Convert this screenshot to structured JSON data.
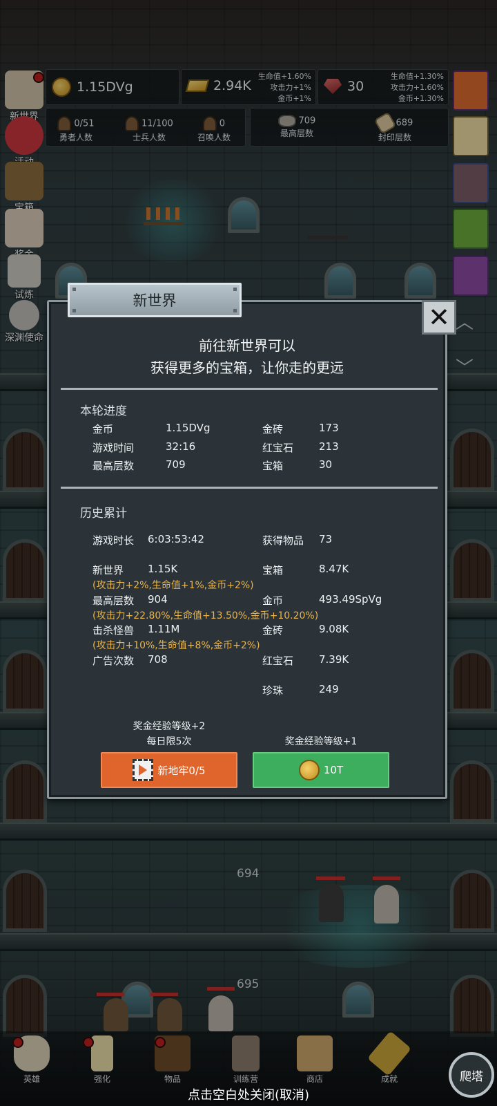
{
  "resources": {
    "gold": "1.15DVg",
    "gold_bar": "2.94K",
    "gold_bar_bonus": [
      "生命值+1.60%",
      "攻击力+1%",
      "金币+1%"
    ],
    "ruby": "30",
    "ruby_bonus": [
      "生命值+1.30%",
      "攻击力+1.60%",
      "金币+1.30%"
    ]
  },
  "counts": {
    "heroes": {
      "value": "0/51",
      "label": "勇者人数"
    },
    "soldiers": {
      "value": "11/100",
      "label": "士兵人数"
    },
    "summons": {
      "value": "0",
      "label": "召唤人数"
    },
    "max_floor": {
      "value": "709",
      "label": "最高层数"
    },
    "sealed_floor": {
      "value": "689",
      "label": "封印层数"
    }
  },
  "side_menu": [
    "新世界",
    "活动",
    "宝箱",
    "奖金",
    "试炼",
    "深渊使命"
  ],
  "dialog": {
    "title": "新世界",
    "intro_line1": "前往新世界可以",
    "intro_line2": "获得更多的宝箱，让你走的更远",
    "current": {
      "title": "本轮进度",
      "rows": [
        {
          "label": "金币",
          "value": "1.15DVg",
          "label2": "金砖",
          "value2": "173"
        },
        {
          "label": "游戏时间",
          "value": "32:16",
          "label2": "红宝石",
          "value2": "213"
        },
        {
          "label": "最高层数",
          "value": "709",
          "label2": "宝箱",
          "value2": "30"
        }
      ]
    },
    "history": {
      "title": "历史累计",
      "play_time_label": "游戏时长",
      "play_time": "6:03:53:42",
      "items_label": "获得物品",
      "items": "73",
      "new_world_label": "新世界",
      "new_world": "1.15K",
      "new_world_bonus": "(攻击力+2%,生命值+1%,金币+2%)",
      "chest_label": "宝箱",
      "chest": "8.47K",
      "max_floor_label": "最高层数",
      "max_floor": "904",
      "gold_label": "金币",
      "gold": "493.49SpVg",
      "max_floor_bonus": "(攻击力+22.80%,生命值+13.50%,金币+10.20%)",
      "kills_label": "击杀怪兽",
      "kills": "1.11M",
      "bar_label": "金砖",
      "bar": "9.08K",
      "kills_bonus": "(攻击力+10%,生命值+8%,金币+2%)",
      "ads_label": "广告次数",
      "ads": "708",
      "ruby_label": "红宝石",
      "ruby": "7.39K",
      "pearl_label": "珍珠",
      "pearl": "249"
    },
    "ad_note_line1": "奖金经验等级+2",
    "ad_note_line2": "每日限5次",
    "pay_note": "奖金经验等级+1",
    "ad_button": "新地牢0/5",
    "pay_button": "10T"
  },
  "floors": {
    "upper": "694",
    "lower": "695"
  },
  "bottom_nav": [
    "英雄",
    "强化",
    "物品",
    "训练营",
    "商店",
    "成就"
  ],
  "climb_button": "爬塔",
  "close_hint": "点击空白处关闭(取消)"
}
